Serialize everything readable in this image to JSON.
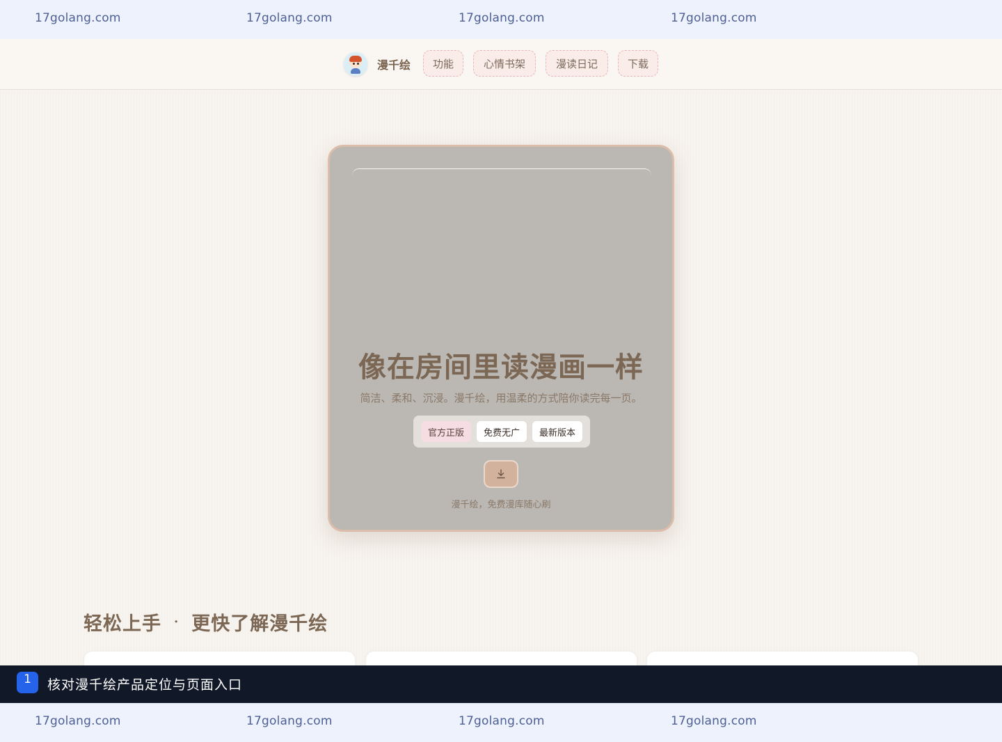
{
  "watermark": {
    "top": [
      "17golang.com",
      "17golang.com",
      "17golang.com",
      "17golang.com"
    ],
    "bottom": [
      "17golang.com",
      "17golang.com",
      "17golang.com",
      "17golang.com"
    ]
  },
  "nav": {
    "brand_name": "漫千绘",
    "items": [
      "功能",
      "心情书架",
      "漫读日记",
      "下载"
    ]
  },
  "hero": {
    "title": "像在房间里读漫画一样",
    "subtitle": "简洁、柔和、沉浸。漫千绘，用温柔的方式陪你读完每一页。",
    "chips": [
      "官方正版",
      "免费无广",
      "最新版本"
    ],
    "download_icon": "download-icon",
    "caption": "漫千绘，免费漫库随心刷"
  },
  "section": {
    "title_left": "轻松上手",
    "separator": "·",
    "title_right": "更快了解漫千绘"
  },
  "step": {
    "number": "1",
    "text": "核对漫千绘产品定位与页面入口"
  },
  "colors": {
    "watermark_bg": "#edf2fd",
    "watermark_text": "#4d5f93",
    "page_bg": "#f7f3ee",
    "hero_bg": "#bbb8b3",
    "accent_brown": "#7b6754",
    "step_bg": "#111827",
    "step_badge": "#2563eb"
  }
}
